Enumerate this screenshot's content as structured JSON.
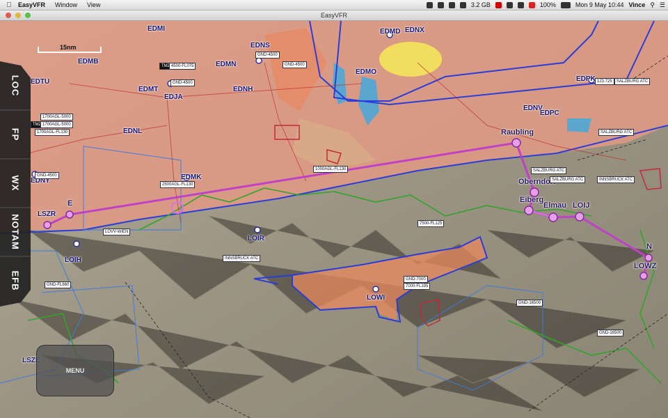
{
  "menubar": {
    "app_name": "EasyVFR",
    "items": [
      "Window",
      "View"
    ],
    "memory": "3.2 GB",
    "battery": "100%",
    "clock": "Mon 9 May  10:44",
    "user": "Vince"
  },
  "window": {
    "title": "EasyVFR"
  },
  "scale": {
    "label": "15nm"
  },
  "sidebar": {
    "tabs": [
      "LOC",
      "FP",
      "WX",
      "NOTAM",
      "EFB"
    ]
  },
  "menu_button": {
    "label": "MENU"
  },
  "airports": {
    "edmi": "EDMI",
    "edmb": "EDMB",
    "edtu": "EDTU",
    "edmt": "EDMT",
    "edja": "EDJA",
    "edns": "EDNS",
    "edmn": "EDMN",
    "ednh": "EDNH",
    "edmd": "EDMD",
    "ednx": "EDNX",
    "edmo": "EDMO",
    "edpk": "EDPK",
    "ednv": "EDNV",
    "edpc": "EDPC",
    "ednl": "EDNL",
    "edmk": "EDMK",
    "edny": "EDNY",
    "lszr": "LSZR",
    "loir": "LOIR",
    "loih": "LOIH",
    "lowi": "LOWI",
    "loij": "LOIJ",
    "lowz": "LOWZ",
    "lsze": "LSZE"
  },
  "route": {
    "raubling": "Raubling",
    "oberndorf": "Oberndorf",
    "eiberg": "Eiberg",
    "elmau": "Elmau",
    "loij": "LOIJ",
    "n": "N",
    "e": "E"
  },
  "airspace_tags": {
    "tmz_edmt": "TMZ",
    "edmt_alt": "4500-FL075",
    "edmt_gnd": "GND-4500",
    "edns_gnd": "GND-4500",
    "edmn_gnd": "GND-4500",
    "l1": "1700AGL-5000",
    "tmz_l2": "TMZ",
    "l2": "1700AGL-5000",
    "l3": "1700AGL-FL130",
    "edny_gnd": "GND-4500",
    "edmk_alt": "2500AGL-FL130",
    "route_alt": "1000AGL-FL130",
    "salzburg1": "SALZBURG ATC",
    "salzburg1_freq": "123.725",
    "salzburg2": "SALZBURG ATC",
    "salzburg3": "SALZBURG ATC",
    "salzburg4": "SALZBURG ATC",
    "innsbruck1": "INNSBRUCK ATC",
    "innsbruck2": "INNSBRUCK ATC",
    "lovv": "LOVV-WIEN",
    "lowi_gnd": "GND-7000",
    "lowi_fl": "7000-FL195",
    "lowi_7500": "7500-FL125",
    "gnd_fl660": "GND-FL660",
    "gnd_16500a": "GND-16500",
    "gnd_16500b": "GND-16500"
  }
}
